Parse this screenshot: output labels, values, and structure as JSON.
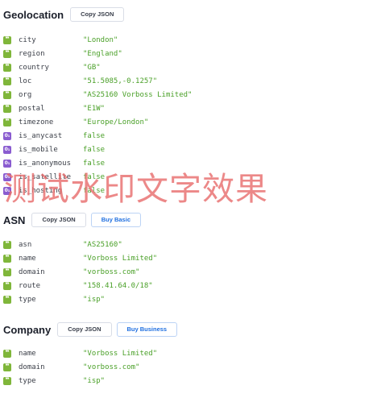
{
  "geolocation": {
    "title": "Geolocation",
    "copy_label": "Copy JSON",
    "rows": [
      {
        "key": "city",
        "value": "\"London\"",
        "icon": "quote-icon"
      },
      {
        "key": "region",
        "value": "\"England\"",
        "icon": "quote-icon"
      },
      {
        "key": "country",
        "value": "\"GB\"",
        "icon": "quote-icon"
      },
      {
        "key": "loc",
        "value": "\"51.5085,-0.1257\"",
        "icon": "quote-icon"
      },
      {
        "key": "org",
        "value": "\"AS25160 Vorboss Limited\"",
        "icon": "quote-icon"
      },
      {
        "key": "postal",
        "value": "\"E1W\"",
        "icon": "quote-icon"
      },
      {
        "key": "timezone",
        "value": "\"Europe/London\"",
        "icon": "quote-icon"
      },
      {
        "key": "is_anycast",
        "value": "false",
        "icon": "boolean-icon"
      },
      {
        "key": "is_mobile",
        "value": "false",
        "icon": "boolean-icon"
      },
      {
        "key": "is_anonymous",
        "value": "false",
        "icon": "boolean-icon"
      },
      {
        "key": "is_satellite",
        "value": "false",
        "icon": "boolean-icon"
      },
      {
        "key": "is_hosting",
        "value": "false",
        "icon": "boolean-icon"
      }
    ]
  },
  "asn": {
    "title": "ASN",
    "copy_label": "Copy JSON",
    "buy_label": "Buy Basic",
    "rows": [
      {
        "key": "asn",
        "value": "\"AS25160\""
      },
      {
        "key": "name",
        "value": "\"Vorboss Limited\""
      },
      {
        "key": "domain",
        "value": "\"vorboss.com\""
      },
      {
        "key": "route",
        "value": "\"158.41.64.0/18\""
      },
      {
        "key": "type",
        "value": "\"isp\""
      }
    ]
  },
  "company": {
    "title": "Company",
    "copy_label": "Copy JSON",
    "buy_label": "Buy Business",
    "rows": [
      {
        "key": "name",
        "value": "\"Vorboss Limited\""
      },
      {
        "key": "domain",
        "value": "\"vorboss.com\""
      },
      {
        "key": "type",
        "value": "\"isp\""
      }
    ]
  },
  "icons": {
    "string_glyph": "❝",
    "boolean_glyph": "0₁"
  },
  "colors": {
    "string_value": "#4aa028",
    "quote_icon_bg": "#7fb63a",
    "boolean_icon_bg": "#8a5cd0",
    "accent_blue": "#1f6fe0",
    "watermark": "#e86e6e"
  },
  "watermark": {
    "text": "测试水印文字效果"
  }
}
